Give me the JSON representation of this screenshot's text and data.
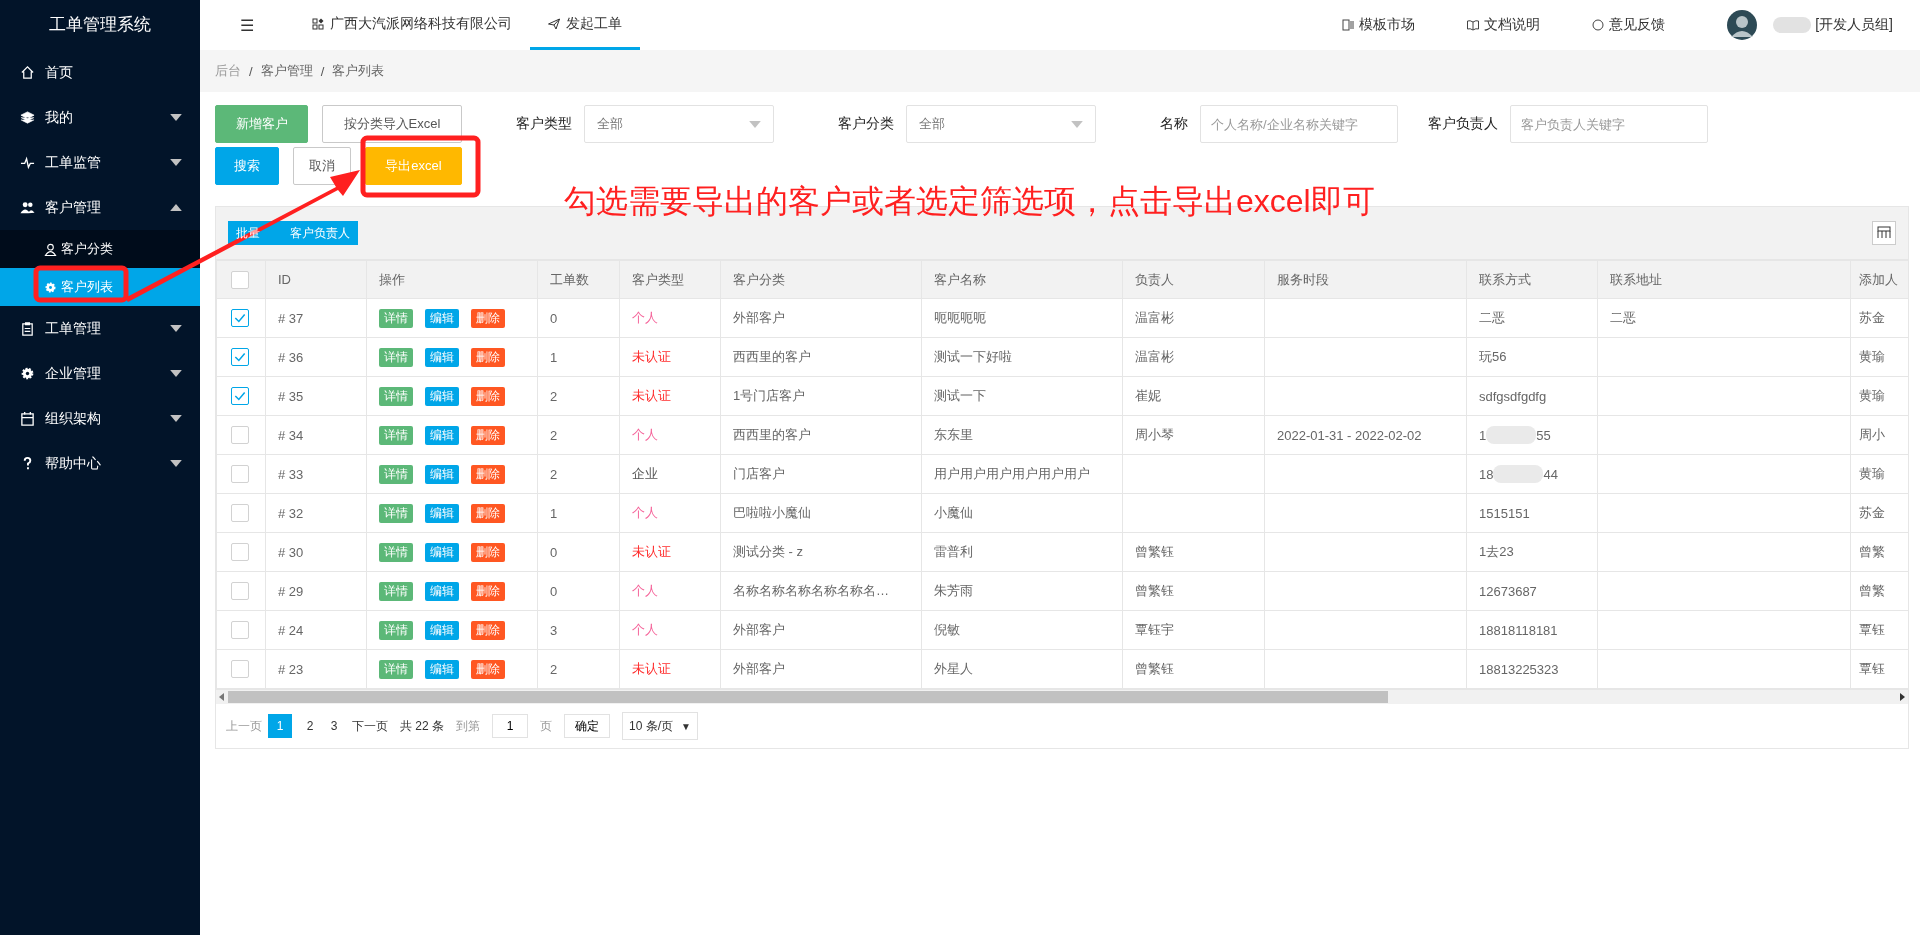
{
  "sidebar": {
    "title": "工单管理系统",
    "items": [
      {
        "label": "首页"
      },
      {
        "label": "我的",
        "expanded": false
      },
      {
        "label": "工单监管",
        "expanded": false
      },
      {
        "label": "客户管理",
        "expanded": true,
        "children": [
          {
            "label": "客户分类",
            "selected": false
          },
          {
            "label": "客户列表",
            "selected": true
          }
        ]
      },
      {
        "label": "工单管理",
        "expanded": false
      },
      {
        "label": "企业管理",
        "expanded": false
      },
      {
        "label": "组织架构",
        "expanded": false
      },
      {
        "label": "帮助中心",
        "expanded": false
      }
    ]
  },
  "topbar": {
    "menu_icon": "☰",
    "tabs": [
      {
        "label": "广西大汽派网络科技有限公司",
        "selected": false
      },
      {
        "label": "发起工单",
        "selected": true
      }
    ],
    "links": [
      "模板市场",
      "文档说明",
      "意见反馈"
    ],
    "user": "[开发人员组]"
  },
  "breadcrumb": {
    "separator": "/",
    "items": [
      "后台",
      "客户管理",
      "客户列表"
    ]
  },
  "buttons": {
    "add": "新增客户",
    "import": "按分类导入Excel",
    "search": "搜索",
    "cancel": "取消",
    "export": "导出excel"
  },
  "filters": [
    {
      "label": "客户类型",
      "kind": "select",
      "value": "全部"
    },
    {
      "label": "客户分类",
      "kind": "select",
      "value": "全部"
    },
    {
      "label": "名称",
      "kind": "input",
      "placeholder": "个人名称/企业名称关键字"
    },
    {
      "label": "客户负责人",
      "kind": "input",
      "placeholder": "客户负责人关键字"
    }
  ],
  "batch_button": {
    "label_start": "批量",
    "label_end": "客户负责人"
  },
  "table": {
    "all_selected": false,
    "columns": [
      "ID",
      "操作",
      "工单数",
      "客户类型",
      "客户分类",
      "客户名称",
      "负责人",
      "服务时段",
      "联系方式",
      "联系地址",
      "添加人"
    ],
    "rows": [
      {
        "selected": true,
        "id": "# 37",
        "actions": [
          "详情",
          "编辑",
          "删除"
        ],
        "orders": "0",
        "type": "个人",
        "color": "#f5649a",
        "category": "外部客户",
        "name": "呃呃呃呃",
        "owner": "温富彬",
        "contact": "二恶",
        "address": "二恶",
        "adder": "苏金"
      },
      {
        "selected": true,
        "id": "# 36",
        "actions": [
          "详情",
          "编辑",
          "删除"
        ],
        "orders": "1",
        "type": "未认证",
        "color": "#ff2d2d",
        "category": "西西里的客户",
        "name": "测试一下好啦",
        "owner": "温富彬",
        "contact": "玩56",
        "adder": "黄瑜"
      },
      {
        "selected": true,
        "id": "# 35",
        "actions": [
          "详情",
          "编辑",
          "删除"
        ],
        "orders": "2",
        "type": "未认证",
        "color": "#ff2d2d",
        "category": "1号门店客户",
        "name": "测试一下",
        "owner": "崔妮",
        "contact": "sdfgsdfgdfg",
        "adder": "黄瑜"
      },
      {
        "selected": false,
        "id": "# 34",
        "actions": [
          "详情",
          "编辑",
          "删除"
        ],
        "orders": "2",
        "type": "个人",
        "color": "#f5649a",
        "category": "西西里的客户",
        "name": "东东里",
        "owner": "周小琴",
        "period": "2022-01-31 - 2022-02-02",
        "contact": "1",
        "contact_end": "55",
        "adder": "周小"
      },
      {
        "selected": false,
        "id": "# 33",
        "actions": [
          "详情",
          "编辑",
          "删除"
        ],
        "orders": "2",
        "type": "企业",
        "color": "#555555",
        "category": "门店客户",
        "name": "用户用户用户用户用户用户",
        "contact": "18",
        "contact_end": "44",
        "adder": "黄瑜"
      },
      {
        "selected": false,
        "id": "# 32",
        "actions": [
          "详情",
          "编辑",
          "删除"
        ],
        "orders": "1",
        "type": "个人",
        "color": "#f5649a",
        "category": "巴啦啦小魔仙",
        "name": "小魔仙",
        "contact": "1515151",
        "adder": "苏金"
      },
      {
        "selected": false,
        "id": "# 30",
        "actions": [
          "详情",
          "编辑",
          "删除"
        ],
        "orders": "0",
        "type": "未认证",
        "color": "#ff2d2d",
        "category": "测试分类 - z",
        "name": "雷普利",
        "owner": "曾繁钰",
        "contact": "1去23",
        "adder": "曾繁"
      },
      {
        "selected": false,
        "id": "# 29",
        "actions": [
          "详情",
          "编辑",
          "删除"
        ],
        "orders": "0",
        "type": "个人",
        "color": "#f5649a",
        "category": "名称名称名称名称名称名…",
        "name": "朱芳雨",
        "owner": "曾繁钰",
        "contact": "12673687",
        "adder": "曾繁"
      },
      {
        "selected": false,
        "id": "# 24",
        "actions": [
          "详情",
          "编辑",
          "删除"
        ],
        "orders": "3",
        "type": "个人",
        "color": "#f5649a",
        "category": "外部客户",
        "name": "倪敏",
        "owner": "覃钰宇",
        "contact": "18818118181",
        "adder": "覃钰"
      },
      {
        "selected": false,
        "id": "# 23",
        "actions": [
          "详情",
          "编辑",
          "删除"
        ],
        "orders": "2",
        "type": "未认证",
        "color": "#ff2d2d",
        "category": "外部客户",
        "name": "外星人",
        "owner": "曾繁钰",
        "contact": "18813225323",
        "adder": "覃钰"
      }
    ]
  },
  "pagination": {
    "prev": "上一页",
    "pages": [
      {
        "label": "1",
        "selected": true
      },
      {
        "label": "2",
        "selected": false
      },
      {
        "label": "3",
        "selected": false
      }
    ],
    "next": "下一页",
    "total": "共 22 条",
    "goto": "到第",
    "page_value": "1",
    "page_unit": "页",
    "confirm": "确定",
    "page_size": "10 条/页",
    "caret": "▼"
  },
  "annotation": {
    "text": "勾选需要导出的客户或者选定筛选项，点击导出excel即可"
  }
}
